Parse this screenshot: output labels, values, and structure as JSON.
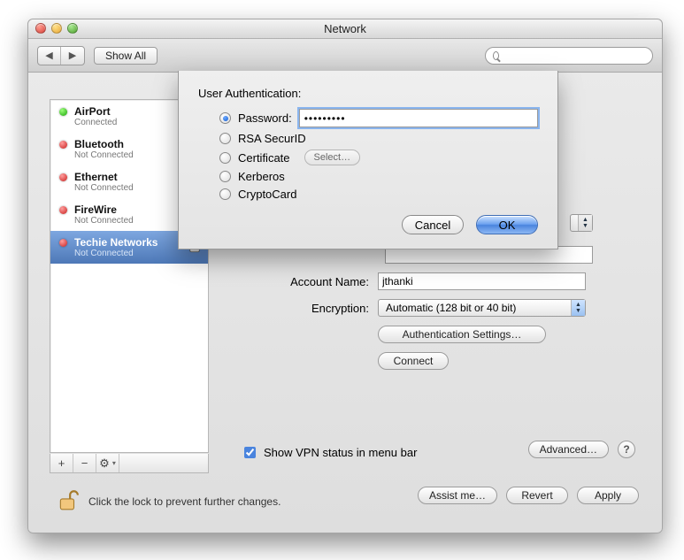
{
  "window": {
    "title": "Network"
  },
  "toolbar": {
    "show_all_label": "Show All",
    "search_placeholder": ""
  },
  "sidebar": {
    "items": [
      {
        "name": "AirPort",
        "status": "Connected",
        "color": "green",
        "selected": false,
        "locked": false
      },
      {
        "name": "Bluetooth",
        "status": "Not Connected",
        "color": "red",
        "selected": false,
        "locked": false
      },
      {
        "name": "Ethernet",
        "status": "Not Connected",
        "color": "red",
        "selected": false,
        "locked": false
      },
      {
        "name": "FireWire",
        "status": "Not Connected",
        "color": "red",
        "selected": false,
        "locked": false
      },
      {
        "name": "Techie Networks",
        "status": "Not Connected",
        "color": "red",
        "selected": true,
        "locked": true
      }
    ],
    "tools": {
      "add": "+",
      "remove": "−",
      "action": "✻"
    }
  },
  "main": {
    "configuration_empty_popup": "",
    "account_name_label": "Account Name:",
    "account_name_value": "jthanki",
    "encryption_label": "Encryption:",
    "encryption_value": "Automatic (128 bit or 40 bit)",
    "auth_settings_label": "Authentication Settings…",
    "connect_label": "Connect",
    "show_vpn_label": "Show VPN status in menu bar",
    "show_vpn_checked": true,
    "advanced_label": "Advanced…",
    "help": "?"
  },
  "sheet": {
    "heading": "User Authentication:",
    "options": {
      "password": {
        "label": "Password:",
        "selected": true
      },
      "securid": {
        "label": "RSA SecurID",
        "selected": false
      },
      "certificate": {
        "label": "Certificate",
        "selected": false
      },
      "kerberos": {
        "label": "Kerberos",
        "selected": false
      },
      "cryptocard": {
        "label": "CryptoCard",
        "selected": false
      }
    },
    "password_mask": "•••••••••",
    "select_label": "Select…",
    "cancel_label": "Cancel",
    "ok_label": "OK"
  },
  "footer": {
    "lock_text": "Click the lock to prevent further changes.",
    "assist_label": "Assist me…",
    "revert_label": "Revert",
    "apply_label": "Apply"
  }
}
